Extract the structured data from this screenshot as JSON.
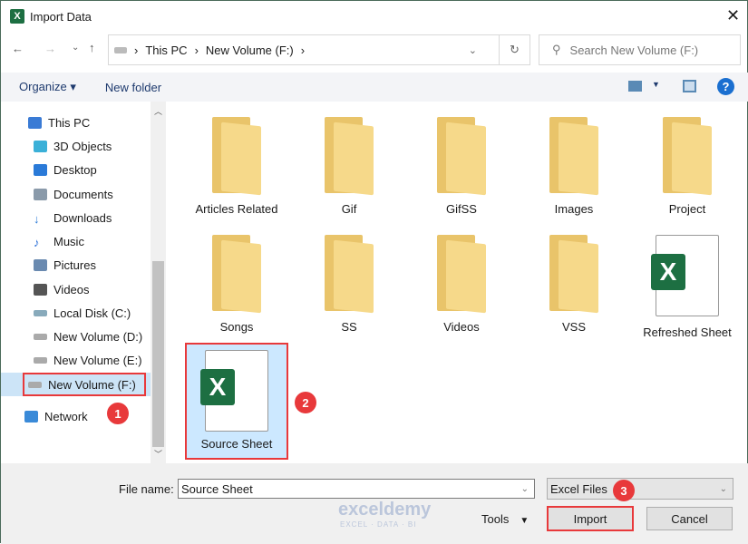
{
  "window": {
    "title": "Import Data",
    "app_icon": "X"
  },
  "nav": {
    "breadcrumb": [
      "This PC",
      "New Volume (F:)"
    ],
    "search_placeholder": "Search New Volume (F:)"
  },
  "toolbar": {
    "organize": "Organize",
    "new_folder": "New folder"
  },
  "sidebar": {
    "items": [
      {
        "label": "This PC",
        "color": "#3a7bd5"
      },
      {
        "label": "3D Objects",
        "color": "#3ab0d8"
      },
      {
        "label": "Desktop",
        "color": "#2a7ad8"
      },
      {
        "label": "Documents",
        "color": "#8a9aaa"
      },
      {
        "label": "Downloads",
        "color": "#2a7ad8"
      },
      {
        "label": "Music",
        "color": "#2a6fd8"
      },
      {
        "label": "Pictures",
        "color": "#6a8ab0"
      },
      {
        "label": "Videos",
        "color": "#555"
      },
      {
        "label": "Local Disk (C:)",
        "color": "#8aa"
      },
      {
        "label": "New Volume (D:)",
        "color": "#999"
      },
      {
        "label": "New Volume (E:)",
        "color": "#999"
      },
      {
        "label": "New Volume (F:)",
        "color": "#999"
      },
      {
        "label": "Network",
        "color": "#3a8ad8"
      }
    ]
  },
  "files": [
    {
      "name": "Articles Related",
      "type": "folder"
    },
    {
      "name": "Gif",
      "type": "folder"
    },
    {
      "name": "GifSS",
      "type": "folder"
    },
    {
      "name": "Images",
      "type": "folder"
    },
    {
      "name": "Project",
      "type": "folder"
    },
    {
      "name": "Songs",
      "type": "folder"
    },
    {
      "name": "SS",
      "type": "folder"
    },
    {
      "name": "Videos",
      "type": "folder"
    },
    {
      "name": "VSS",
      "type": "folder"
    },
    {
      "name": "Refreshed Sheet",
      "type": "excel"
    },
    {
      "name": "Source Sheet",
      "type": "excel"
    }
  ],
  "footer": {
    "file_name_label": "File name:",
    "file_name_value": "Source Sheet",
    "file_type": "Excel Files",
    "tools": "Tools",
    "import": "Import",
    "cancel": "Cancel"
  },
  "annotations": [
    "1",
    "2",
    "3"
  ],
  "watermark": {
    "brand": "exceldemy",
    "tagline": "EXCEL · DATA · BI"
  }
}
